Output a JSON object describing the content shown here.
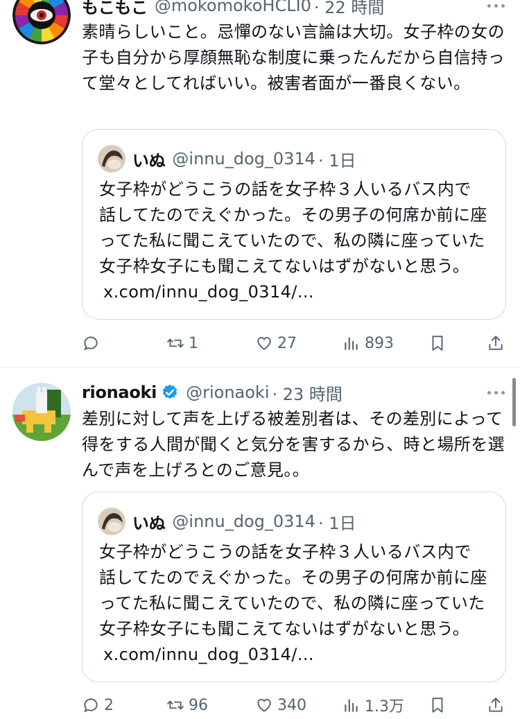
{
  "tweets": [
    {
      "name": "もこもこ",
      "handle": "@mokomokoHCLI0",
      "time": "· 22 時間",
      "text": "素晴らしいこと。忌憚のない言論は大切。女子枠の女の子も自分から厚顔無恥な制度に乗ったんだから自信持って堂々としてればいい。被害者面が一番良くない。",
      "quote": {
        "name": "いぬ",
        "handle": "@innu_dog_0314",
        "time": "· 1日",
        "text": "女子枠がどうこうの話を女子枠３人いるバス内で話してたのでえぐかった。その男子の何席か前に座ってた私に聞こえていたので、私の隣に座っていた女子枠女子にも聞こえてないはずがないと思う。",
        "link": "x.com/innu_dog_0314/..."
      },
      "stats": {
        "replies": "",
        "retweets": "1",
        "likes": "27",
        "views": "893"
      }
    },
    {
      "name": "rionaoki",
      "handle": "@rionaoki",
      "time": "· 23 時間",
      "verified": true,
      "text": "差別に対して声を上げる被差別者は、その差別によって得をする人間が聞くと気分を害するから、時と場所を選んで声を上げろとのご意見。。",
      "quote": {
        "name": "いぬ",
        "handle": "@innu_dog_0314",
        "time": "· 1日",
        "text": "女子枠がどうこうの話を女子枠３人いるバス内で話してたのでえぐかった。その男子の何席か前に座ってた私に聞こえていたので、私の隣に座っていた女子枠女子にも聞こえてないはずがないと思う。",
        "link": "x.com/innu_dog_0314/..."
      },
      "stats": {
        "replies": "2",
        "retweets": "96",
        "likes": "340",
        "views": "1.3万"
      }
    }
  ],
  "icons": [
    "reply-icon",
    "retweet-icon",
    "like-icon",
    "views-icon",
    "bookmark-icon",
    "share-icon",
    "more-icon",
    "verified-icon"
  ],
  "colors": {
    "text": "#0f1419",
    "secondary": "#536471",
    "border": "#cfd9de",
    "verified": "#1d9bf0"
  }
}
